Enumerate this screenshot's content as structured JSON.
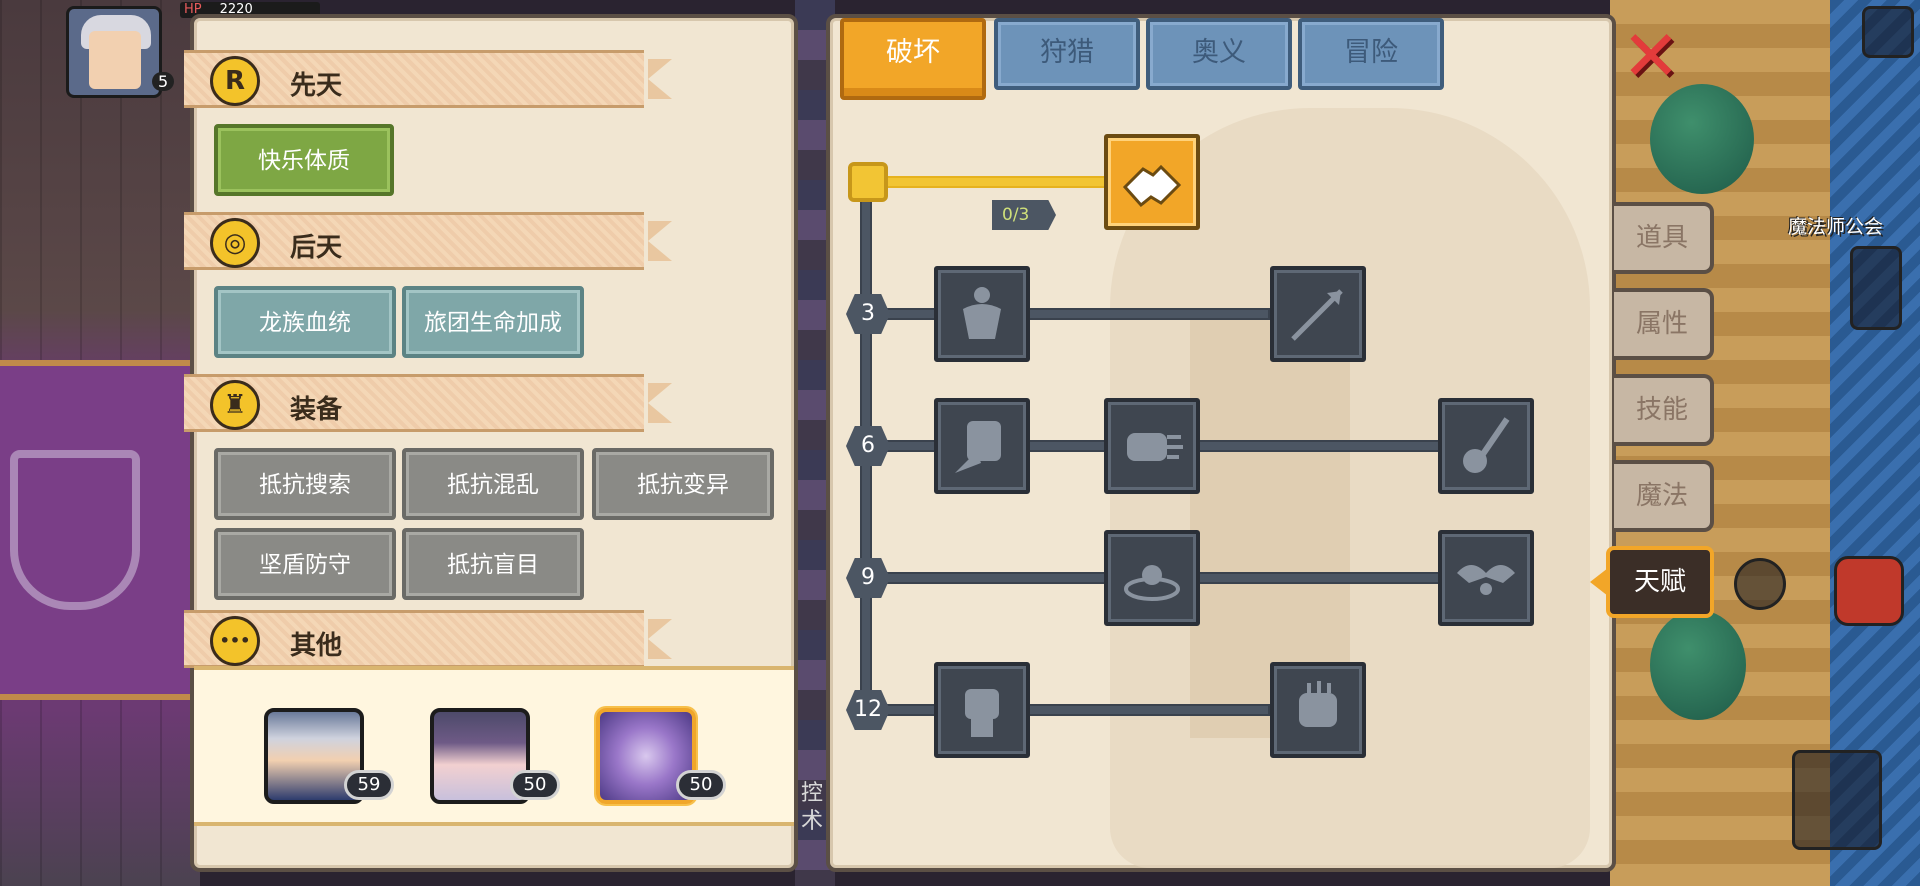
{
  "hud": {
    "hp_label": "HP",
    "hp_value": "2220",
    "player_level": "5"
  },
  "left_panel": {
    "sections": [
      {
        "title": "先天",
        "icon": "rank-r-icon",
        "icon_glyph": "R"
      },
      {
        "title": "后天",
        "icon": "swirl-icon",
        "icon_glyph": "◎"
      },
      {
        "title": "装备",
        "icon": "armor-icon",
        "icon_glyph": "♜"
      },
      {
        "title": "其他",
        "icon": "dots-icon",
        "icon_glyph": "•••"
      }
    ],
    "innate_tags": [
      "快乐体质"
    ],
    "acquired_tags": [
      "龙族血统",
      "旅团生命加成"
    ],
    "equipment_tags": [
      "抵抗搜索",
      "抵抗混乱",
      "抵抗变异",
      "坚盾防守",
      "抵抗盲目"
    ]
  },
  "characters": [
    {
      "level": "59",
      "selected": false
    },
    {
      "level": "50",
      "selected": false
    },
    {
      "level": "50",
      "selected": true
    }
  ],
  "tabs": [
    {
      "label": "破坏",
      "active": true
    },
    {
      "label": "狩猎",
      "active": false
    },
    {
      "label": "奥义",
      "active": false
    },
    {
      "label": "冒险",
      "active": false
    }
  ],
  "talent_tree": {
    "first_skill_progress": "0/3",
    "tiers": [
      "3",
      "6",
      "9",
      "12"
    ]
  },
  "side_menu": [
    {
      "label": "道具",
      "active": false
    },
    {
      "label": "属性",
      "active": false
    },
    {
      "label": "技能",
      "active": false
    },
    {
      "label": "魔法",
      "active": false
    },
    {
      "label": "天赋",
      "active": true
    }
  ],
  "map": {
    "location_label": "魔法师公会"
  },
  "behind_panel_text": "控术",
  "colors": {
    "accent_orange": "#f2a628",
    "panel_bg": "#f1e6d2",
    "tab_blue": "#6d93b9",
    "close_red": "#e33b3b"
  }
}
